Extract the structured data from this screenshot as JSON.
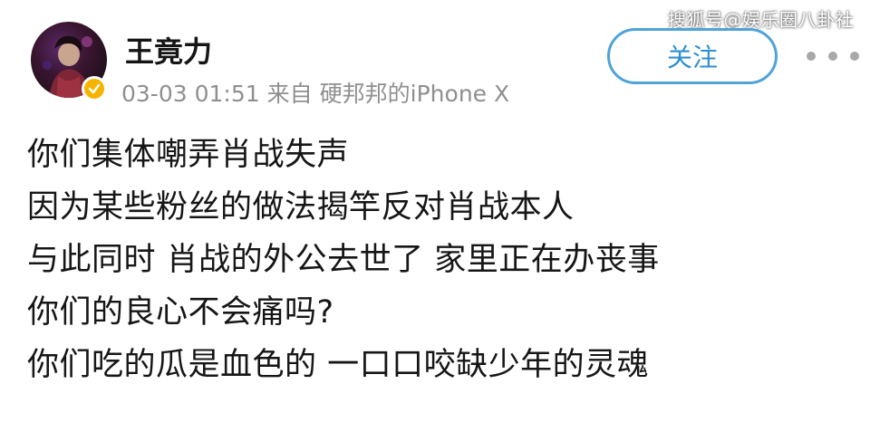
{
  "watermark": "搜狐号@娱乐圈八卦社",
  "post": {
    "author": {
      "name": "王竟力",
      "verified": true,
      "badge_color": "#f6b400"
    },
    "date": "03-03 01:51",
    "source_prefix": "来自",
    "source_device": "硬邦邦的iPhone X",
    "follow_label": "关注",
    "more_icon": "more-horizontal-icon",
    "lines": [
      "你们集体嘲弄肖战失声",
      "因为某些粉丝的做法揭竿反对肖战本人",
      "与此同时 肖战的外公去世了 家里正在办丧事",
      "你们的良心不会痛吗?",
      "你们吃的瓜是血色的 一口口咬缺少年的灵魂"
    ]
  },
  "colors": {
    "accent": "#2f8fcf",
    "button_border": "#4ea3d8",
    "meta_text": "#8f8f8f",
    "body_text": "#161616"
  }
}
